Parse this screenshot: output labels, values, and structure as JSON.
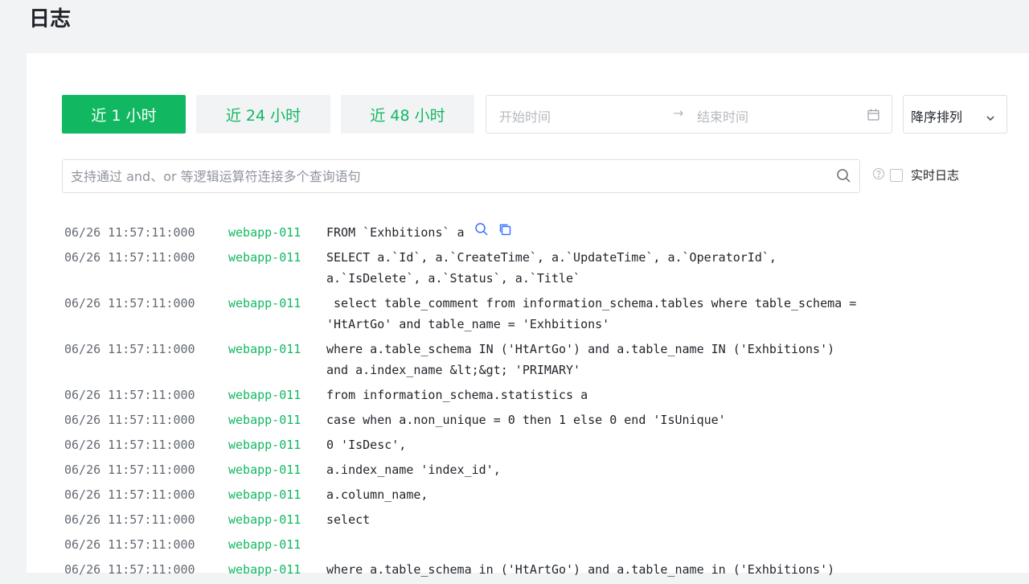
{
  "page": {
    "title": "日志"
  },
  "toolbar": {
    "time_ranges": [
      "近 1 小时",
      "近 24 小时",
      "近 48 小时"
    ],
    "date_start_placeholder": "开始时间",
    "date_arrow": "→",
    "date_end_placeholder": "结束时间",
    "sort_value": "降序排列"
  },
  "search": {
    "placeholder": "支持通过 and、or 等逻辑运算符连接多个查询语句"
  },
  "realtime": {
    "label": "实时日志"
  },
  "colors": {
    "accent": "#11b861",
    "timestamp": "#646a73",
    "text": "#1f2329"
  },
  "icons": [
    "calendar-icon",
    "chevron-down-icon",
    "search-icon",
    "help-circle-icon",
    "magnifier-icon",
    "copy-icon"
  ],
  "logs": [
    {
      "time": "06/26 11:57:11:000",
      "host": "webapp-011",
      "message": "FROM `Exhbitions` a"
    },
    {
      "time": "06/26 11:57:11:000",
      "host": "webapp-011",
      "message": "SELECT a.`Id`, a.`CreateTime`, a.`UpdateTime`, a.`OperatorId`,\na.`IsDelete`, a.`Status`, a.`Title`"
    },
    {
      "time": "06/26 11:57:11:000",
      "host": "webapp-011",
      "message": " select table_comment from information_schema.tables where table_schema =\n'HtArtGo' and table_name = 'Exhbitions'"
    },
    {
      "time": "06/26 11:57:11:000",
      "host": "webapp-011",
      "message": "where a.table_schema IN ('HtArtGo') and a.table_name IN ('Exhbitions')\nand a.index_name &lt;&gt; 'PRIMARY'"
    },
    {
      "time": "06/26 11:57:11:000",
      "host": "webapp-011",
      "message": "from information_schema.statistics a"
    },
    {
      "time": "06/26 11:57:11:000",
      "host": "webapp-011",
      "message": "case when a.non_unique = 0 then 1 else 0 end 'IsUnique'"
    },
    {
      "time": "06/26 11:57:11:000",
      "host": "webapp-011",
      "message": "0 'IsDesc',"
    },
    {
      "time": "06/26 11:57:11:000",
      "host": "webapp-011",
      "message": "a.index_name 'index_id',"
    },
    {
      "time": "06/26 11:57:11:000",
      "host": "webapp-011",
      "message": "a.column_name,"
    },
    {
      "time": "06/26 11:57:11:000",
      "host": "webapp-011",
      "message": "select"
    },
    {
      "time": "06/26 11:57:11:000",
      "host": "webapp-011",
      "message": ""
    },
    {
      "time": "06/26 11:57:11:000",
      "host": "webapp-011",
      "message": "where a.table_schema in ('HtArtGo') and a.table_name in ('Exhbitions')"
    }
  ]
}
